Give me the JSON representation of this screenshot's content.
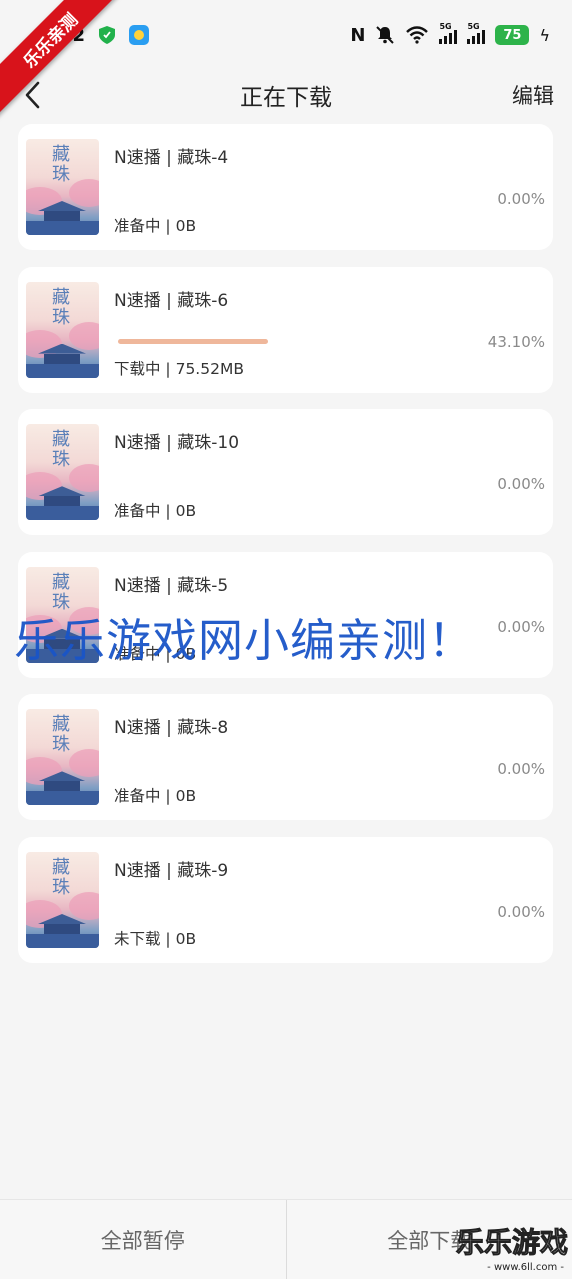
{
  "status_bar": {
    "time": "42",
    "signal_label": "5G",
    "battery": "75"
  },
  "nav": {
    "title": "正在下载",
    "edit_label": "编辑"
  },
  "cover_title": "藏珠",
  "downloads": [
    {
      "title": "N速播 | 藏珠-4",
      "status": "准备中 | 0B",
      "percent": "0.00%",
      "progress": 0
    },
    {
      "title": "N速播 | 藏珠-6",
      "status": "下载中 | 75.52MB",
      "percent": "43.10%",
      "progress": 43.1
    },
    {
      "title": "N速播 | 藏珠-10",
      "status": "准备中 | 0B",
      "percent": "0.00%",
      "progress": 0
    },
    {
      "title": "N速播 | 藏珠-5",
      "status": "准备中 | 0B",
      "percent": "0.00%",
      "progress": 0
    },
    {
      "title": "N速播 | 藏珠-8",
      "status": "准备中 | 0B",
      "percent": "0.00%",
      "progress": 0
    },
    {
      "title": "N速播 | 藏珠-9",
      "status": "未下载 | 0B",
      "percent": "0.00%",
      "progress": 0
    }
  ],
  "bottom": {
    "pause_all": "全部暂停",
    "download_all": "全部下载"
  },
  "watermark": {
    "ribbon": "乐乐亲测",
    "overlay": "乐乐游戏网小编亲测！",
    "logo": "乐乐游戏",
    "logo_url": "- www.6ll.com -"
  },
  "colors": {
    "progress": "#efb79b",
    "battery": "#2db34a",
    "ribbon": "#d8131b",
    "overlay_text": "#1a55c8"
  }
}
